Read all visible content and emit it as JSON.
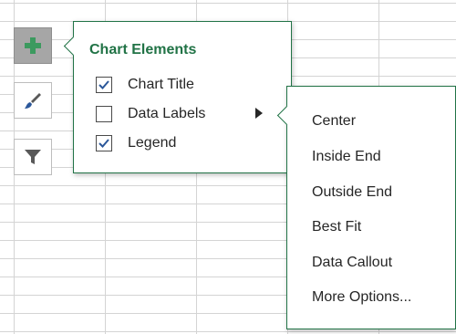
{
  "side_buttons": [
    {
      "icon": "plus-icon",
      "active": true
    },
    {
      "icon": "brush-icon",
      "active": false
    },
    {
      "icon": "filter-icon",
      "active": false
    }
  ],
  "chart_elements": {
    "title": "Chart Elements",
    "items": [
      {
        "label": "Chart Title",
        "checked": true
      },
      {
        "label": "Data Labels",
        "checked": false,
        "has_submenu": true
      },
      {
        "label": "Legend",
        "checked": true
      }
    ]
  },
  "data_labels_menu": {
    "items": [
      "Center",
      "Inside End",
      "Outside End",
      "Best Fit",
      "Data Callout",
      "More Options..."
    ]
  },
  "colors": {
    "accent_green": "#217346",
    "checkmark_blue": "#2b579a",
    "gridline": "#d4d4d4"
  }
}
